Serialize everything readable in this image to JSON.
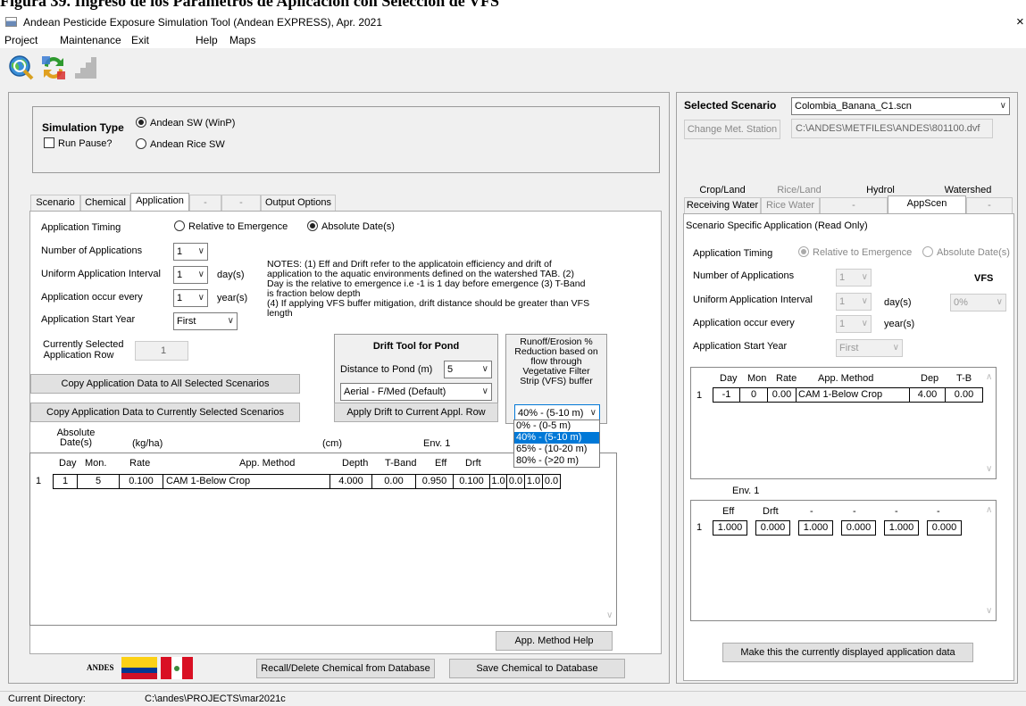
{
  "document_heading": "Figura 39.  Ingreso de los Parámetros de Aplicación con Selección de VFS",
  "window": {
    "title": "Andean Pesticide Exposure Simulation Tool (Andean EXPRESS), Apr. 2021",
    "close": "×"
  },
  "menu": [
    "Project",
    "Maintenance",
    "Exit",
    "Help",
    "Maps"
  ],
  "simulation": {
    "label": "Simulation Type",
    "option_sw": "Andean SW (WinP)",
    "option_rice": "Andean Rice SW",
    "run_pause": "Run Pause?"
  },
  "tabs": [
    "Scenario",
    "Chemical",
    "Application",
    "-",
    "-",
    "Output Options"
  ],
  "application": {
    "timing_label": "Application Timing",
    "timing_relative": "Relative to Emergence",
    "timing_absolute": "Absolute Date(s)",
    "num_apps_label": "Number of Applications",
    "num_apps_value": "1",
    "interval_label": "Uniform Application Interval",
    "interval_value": "1",
    "interval_unit": "day(s)",
    "every_label": "Application occur every",
    "every_value": "1",
    "every_unit": "year(s)",
    "start_year_label": "Application Start Year",
    "start_year_value": "First",
    "row_label_1": "Currently Selected",
    "row_label_2": "Application Row",
    "row_value": "1",
    "notes": [
      "NOTES: (1) Eff and Drift refer to the applicatoin efficiency and drift of",
      "application to the aquatic environments defined on the watershed TAB. (2)",
      "Day is the relative to emergence i.e -1 is 1 day before emergence (3) T-Band",
      "is fraction below depth",
      "(4) If applying VFS buffer mitigation, drift distance should be greater than VFS",
      "length"
    ],
    "copy_all_btn": "Copy Application Data to All Selected Scenarios",
    "copy_current_btn": "Copy Application Data to Currently Selected Scenarios",
    "app_method_help_btn": "App. Method Help"
  },
  "drift_tool": {
    "title": "Drift Tool for Pond",
    "distance_label": "Distance to Pond (m)",
    "distance_value": "5",
    "method_value": "Aerial - F/Med (Default)",
    "apply_btn": "Apply Drift to Current Appl. Row"
  },
  "vfs": {
    "label_lines": [
      "Runoff/Erosion %",
      "Reduction based on",
      "flow through",
      "Vegetative Filter",
      "Strip (VFS) buffer"
    ],
    "selected": "40% - (5-10 m)",
    "options": [
      "0% - (0-5 m)",
      "40% - (5-10 m)",
      "65% - (10-20 m)",
      "80% - (>20 m)"
    ]
  },
  "app_table": {
    "group_headers": {
      "absolute": "Absolute",
      "dates": "Date(s)",
      "kgha": "(kg/ha)",
      "cm": "(cm)",
      "env1": "Env. 1"
    },
    "columns": [
      "Day",
      "Mon.",
      "Rate",
      "App. Method",
      "Depth",
      "T-Band",
      "Eff",
      "Drft"
    ],
    "rows": [
      {
        "idx": "1",
        "day": "1",
        "mon": "5",
        "rate": "0.100",
        "method": "CAM 1-Below Crop",
        "depth": "4.000",
        "tband": "0.00",
        "eff": "0.950",
        "drft": "0.100",
        "extra": [
          "1.0",
          "0.0",
          "1.0",
          "0.0"
        ]
      }
    ]
  },
  "bottom_bar": {
    "logo_text": "ANDES",
    "recall_btn": "Recall/Delete Chemical from Database",
    "save_btn": "Save Chemical to Database"
  },
  "status": {
    "label": "Current Directory:",
    "value": "C:\\andes\\PROJECTS\\mar2021c"
  },
  "scenario_panel": {
    "selected_label": "Selected Scenario",
    "selected_value": "Colombia_Banana_C1.scn",
    "change_met_btn": "Change Met. Station",
    "met_path": "C:\\ANDES\\METFILES\\ANDES\\801100.dvf",
    "tabs_row1": [
      "Crop/Land",
      "Rice/Land",
      "Hydrol",
      "Watershed"
    ],
    "tabs_row2": [
      "Receiving Water",
      "Rice Water",
      "-",
      "AppScen",
      "-"
    ],
    "readonly_title": "Scenario Specific Application (Read Only)",
    "timing_label": "Application Timing",
    "timing_relative": "Relative to Emergence",
    "timing_absolute": "Absolute Date(s)",
    "num_apps_label": "Number of Applications",
    "num_apps_value": "1",
    "vfs_label": "VFS",
    "vfs_value": "0%",
    "interval_label": "Uniform Application Interval",
    "interval_value": "1",
    "interval_unit": "day(s)",
    "every_label": "Application occur every",
    "every_value": "1",
    "every_unit": "year(s)",
    "start_year_label": "Application Start Year",
    "start_year_value": "First",
    "table1_columns": [
      "Day",
      "Mon",
      "Rate",
      "App. Method",
      "Dep",
      "T-B"
    ],
    "table1_rows": [
      {
        "idx": "1",
        "day": "-1",
        "mon": "0",
        "rate": "0.00",
        "method": "CAM 1-Below Crop",
        "dep": "4.00",
        "tb": "0.00"
      }
    ],
    "table2_group": "Env. 1",
    "table2_columns": [
      "Eff",
      "Drft",
      "-",
      "-",
      "-",
      "-"
    ],
    "table2_rows": [
      {
        "idx": "1",
        "values": [
          "1.000",
          "0.000",
          "1.000",
          "0.000",
          "1.000",
          "0.000"
        ]
      }
    ],
    "make_current_btn": "Make this the currently displayed application data"
  }
}
